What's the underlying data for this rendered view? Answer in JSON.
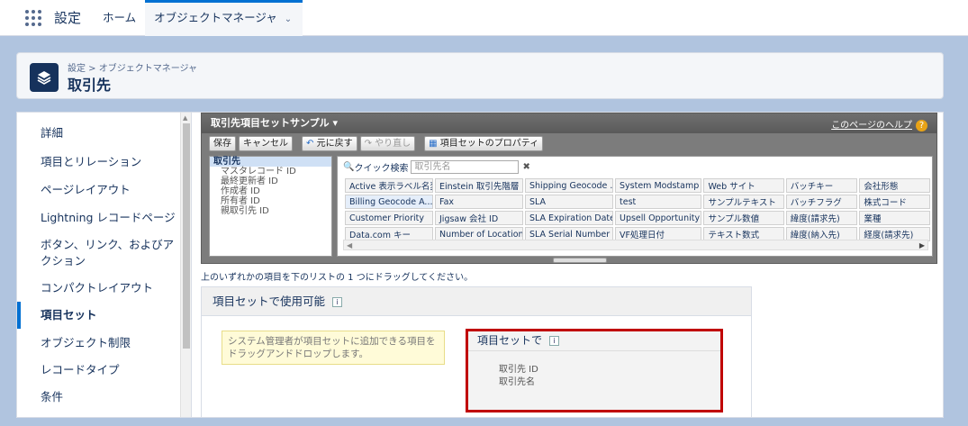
{
  "topnav": {
    "app_name": "設定",
    "tabs": [
      {
        "label": "ホーム"
      },
      {
        "label": "オブジェクトマネージャ"
      }
    ]
  },
  "header": {
    "breadcrumb": "設定 > オブジェクトマネージャ",
    "title": "取引先"
  },
  "sidebar": {
    "items": [
      {
        "label": "詳細"
      },
      {
        "label": "項目とリレーション"
      },
      {
        "label": "ページレイアウト"
      },
      {
        "label": "Lightning レコードページ"
      },
      {
        "label": "ボタン、リンク、およびアクション"
      },
      {
        "label": "コンパクトレイアウト"
      },
      {
        "label": "項目セット"
      },
      {
        "label": "オブジェクト制限"
      },
      {
        "label": "レコードタイプ"
      },
      {
        "label": "条件"
      }
    ],
    "active_index": 6
  },
  "palette": {
    "title": "取引先項目セットサンプル",
    "help_link": "このページのヘルプ",
    "toolbar": {
      "save": "保存",
      "cancel": "キャンセル",
      "undo": "元に戻す",
      "redo": "やり直し",
      "properties": "項目セットのプロパティ"
    },
    "categories": [
      {
        "label": "取引先"
      },
      {
        "label": "マスタレコード ID"
      },
      {
        "label": "最終更新者 ID"
      },
      {
        "label": "作成者 ID"
      },
      {
        "label": "所有者 ID"
      },
      {
        "label": "親取引先 ID"
      }
    ],
    "quick_search_label": "クイック検索",
    "quick_search_placeholder": "取引先名",
    "fields": [
      [
        "Active 表示ラベル名変更",
        "Einstein 取引先階層",
        "Shipping Geocode ...",
        "System Modstamp",
        "Web サイト",
        "バッチキー",
        "会社形態"
      ],
      [
        "Billing Geocode A...",
        "Fax",
        "SLA",
        "test",
        "サンプルテキスト",
        "バッチフラグ",
        "株式コード"
      ],
      [
        "Customer Priority",
        "Jigsaw 会社 ID",
        "SLA Expiration Date",
        "Upsell Opportunity",
        "サンプル数値",
        "緯度(請求先)",
        "業種"
      ],
      [
        "Data.com キー",
        "Number of Locations",
        "SLA Serial Number",
        "VF処理日付",
        "テキスト数式",
        "緯度(納入先)",
        "経度(請求先)"
      ]
    ]
  },
  "instruction": "上のいずれかの項目を下のリストの 1 つにドラッグしてください。",
  "section": {
    "title": "項目セットで使用可能",
    "note": "システム管理者が項目セットに追加できる項目をドラッグアンドドロップします。",
    "inset_title": "項目セットで",
    "inset_fields": [
      {
        "label": "取引先 ID"
      },
      {
        "label": "取引先名"
      }
    ]
  }
}
